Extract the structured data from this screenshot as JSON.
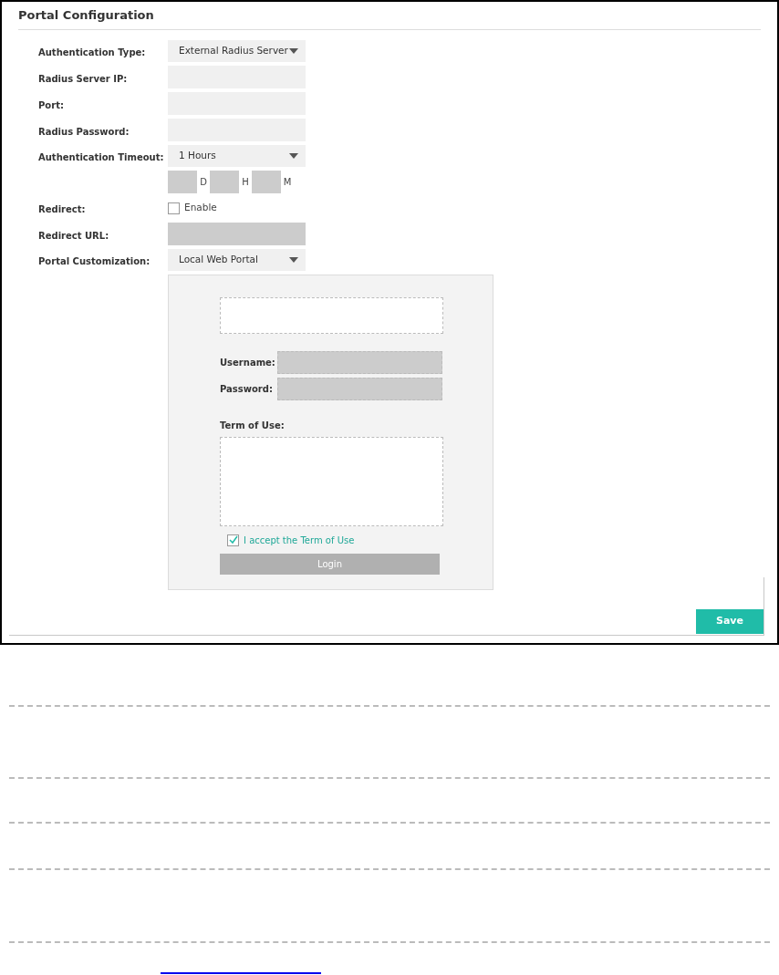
{
  "title": "Portal Configuration",
  "fields": [
    {
      "label": "Authentication Type:",
      "kind": "select",
      "value": "External Radius Server"
    },
    {
      "label": "Radius Server IP:",
      "kind": "input",
      "disabled": false
    },
    {
      "label": "Port:",
      "kind": "input",
      "disabled": false
    },
    {
      "label": "Radius Password:",
      "kind": "input",
      "disabled": false
    },
    {
      "label": "Authentication Timeout:",
      "kind": "select",
      "value": "1 Hours"
    },
    {
      "kind": "duration",
      "units": [
        "D",
        "H",
        "M"
      ]
    },
    {
      "label": "Redirect:",
      "kind": "checkbox",
      "option": "Enable",
      "checked": false
    },
    {
      "label": "Redirect URL:",
      "kind": "input",
      "disabled": true
    },
    {
      "label": "Portal Customization:",
      "kind": "select",
      "value": "Local Web Portal"
    }
  ],
  "preview": {
    "username_label": "Username:",
    "password_label": "Password:",
    "terms_label": "Term of Use:",
    "accept": {
      "label": "I accept the Term of Use",
      "checked": true
    },
    "login_button": "Login"
  },
  "save_button": "Save"
}
